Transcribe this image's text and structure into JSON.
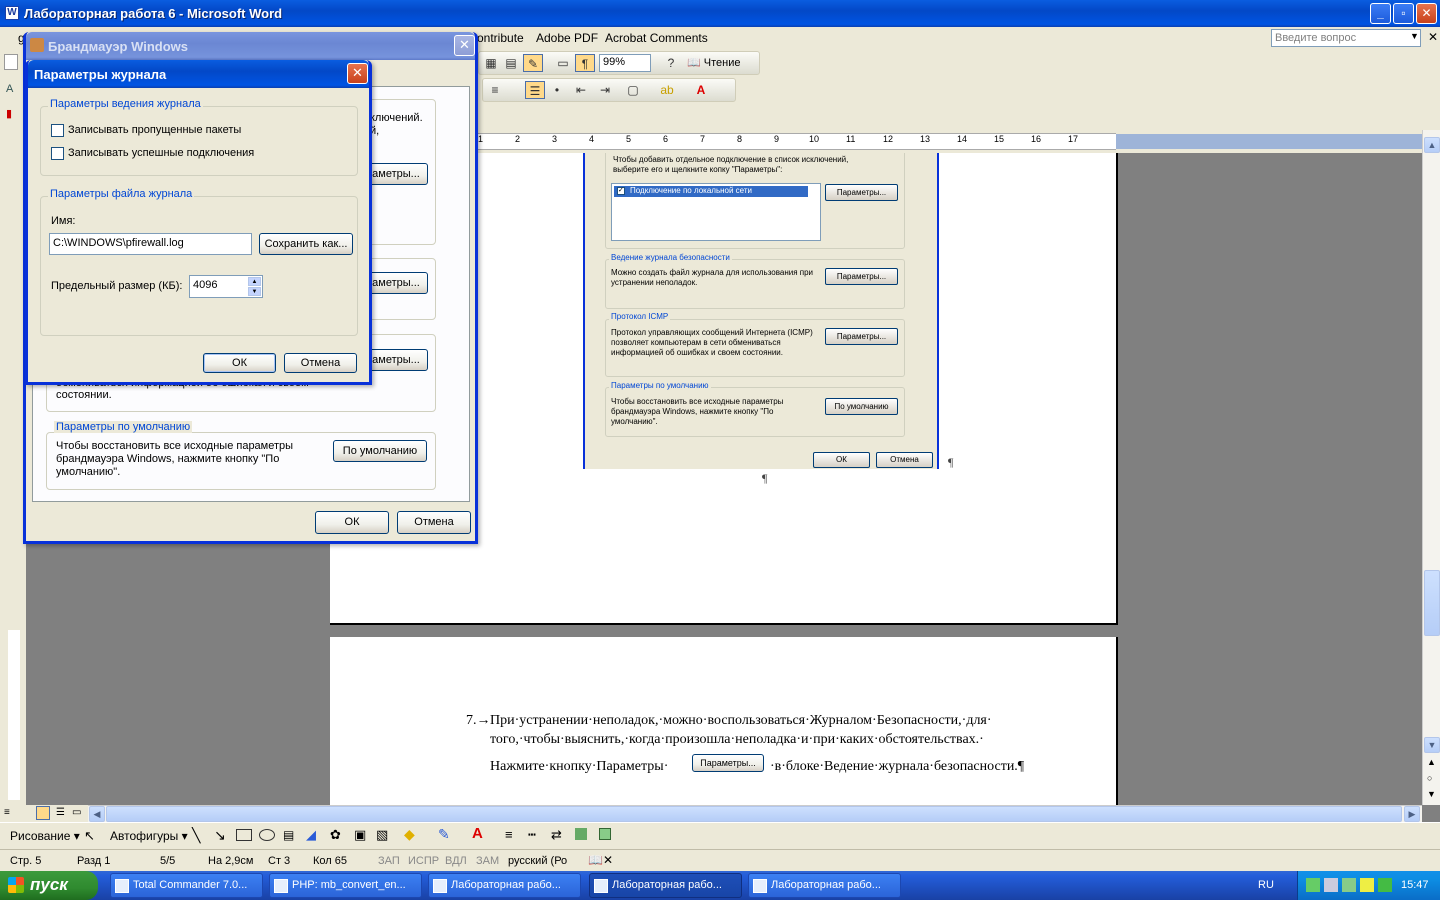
{
  "word": {
    "title": "Лабораторная работа 6 - Microsoft Word",
    "menu_fragment_left": "g",
    "menu_items": [
      "ontribute",
      "Adobe PDF",
      "Acrobat Comments"
    ],
    "help_placeholder": "Введите вопрос",
    "zoom": "99%",
    "reading_label": "Чтение",
    "ruler_numbers": [
      "1",
      "2",
      "3",
      "4",
      "5",
      "6",
      "7",
      "8",
      "9",
      "10",
      "11",
      "12",
      "13",
      "14",
      "15",
      "16",
      "17"
    ]
  },
  "firewall_dialog": {
    "title": "Брандмауэр Windows",
    "partial_text_1": "ключений.",
    "partial_text_2": "й,",
    "partial_btn": "аметры...",
    "partial_icmp_text": "обмениваться информацией об ошибках и своем состоянии.",
    "defaults_group": "Параметры по умолчанию",
    "defaults_text": "Чтобы восстановить все исходные параметры брандмауэра Windows, нажмите кнопку \"По умолчанию\".",
    "defaults_button": "По умолчанию",
    "ok": "ОК",
    "cancel": "Отмена"
  },
  "log_dialog": {
    "title": "Параметры журнала",
    "logging_group": "Параметры ведения журнала",
    "log_dropped": "Записывать пропущенные пакеты",
    "log_success": "Записывать успешные подключения",
    "file_group": "Параметры файла журнала",
    "name_label": "Имя:",
    "name_value": "C:\\WINDOWS\\pfirewall.log",
    "save_as": "Сохранить как...",
    "size_label": "Предельный размер (КБ):",
    "size_value": "4096",
    "ok": "ОК",
    "cancel": "Отмена"
  },
  "doc_image": {
    "top_text": "Чтобы добавить отдельное подключение в список исключений, выберите его и щелкните копку \"Параметры\":",
    "connection_item": "Подключение по локальной сети",
    "params_btn": "Параметры...",
    "security_group": "Ведение журнала безопасности",
    "security_text": "Можно создать файл журнала для использования при устранении неполадок.",
    "icmp_group": "Протокол ICMP",
    "icmp_text": "Протокол управляющих сообщений Интернета (ICMP) позволяет компьютерам в сети обмениваться информацией об ошибках и своем состоянии.",
    "defaults_group": "Параметры по умолчанию",
    "defaults_text": "Чтобы восстановить все исходные параметры брандмауэра Windows, нажмите кнопку \"По умолчанию\".",
    "defaults_btn": "По умолчанию",
    "ok": "ОК",
    "cancel": "Отмена",
    "pilcrow": "¶"
  },
  "doc_text": {
    "item_number": "7.→",
    "line1": "При·устранении·неполадок,·можно·воспользоваться·Журналом·Безопасности,·для·",
    "line2": "того,·чтобы·выяснить,·когда·произошла·неполадка·и·при·каких·обстоятельствах.·",
    "line3_start": "Нажмите·кнопку·Параметры·",
    "inline_btn": "Параметры...",
    "line3_end": "·в·блоке·Ведение·журнала·безопасности.¶"
  },
  "drawing_toolbar": {
    "drawing": "Рисование ▾",
    "autoshapes": "Автофигуры ▾"
  },
  "status": {
    "page": "Стр. 5",
    "section": "Разд 1",
    "pages": "5/5",
    "at": "На 2,9см",
    "line": "Ст 3",
    "col": "Кол 65",
    "rec": "ЗАП",
    "trk": "ИСПР",
    "ext": "ВДЛ",
    "ovr": "ЗАМ",
    "lang": "русский (Ро"
  },
  "taskbar": {
    "start": "пуск",
    "items": [
      "Total Commander 7.0...",
      "PHP: mb_convert_en...",
      "Лабораторная рабо...",
      "Лабораторная рабо...",
      "Лабораторная рабо..."
    ],
    "lang": "RU",
    "time": "15:47"
  },
  "colors": {
    "xp_blue": "#0054e3",
    "dialog_bg": "#ece9d8",
    "group_label": "#0046d5",
    "close_red": "#c8421c"
  }
}
